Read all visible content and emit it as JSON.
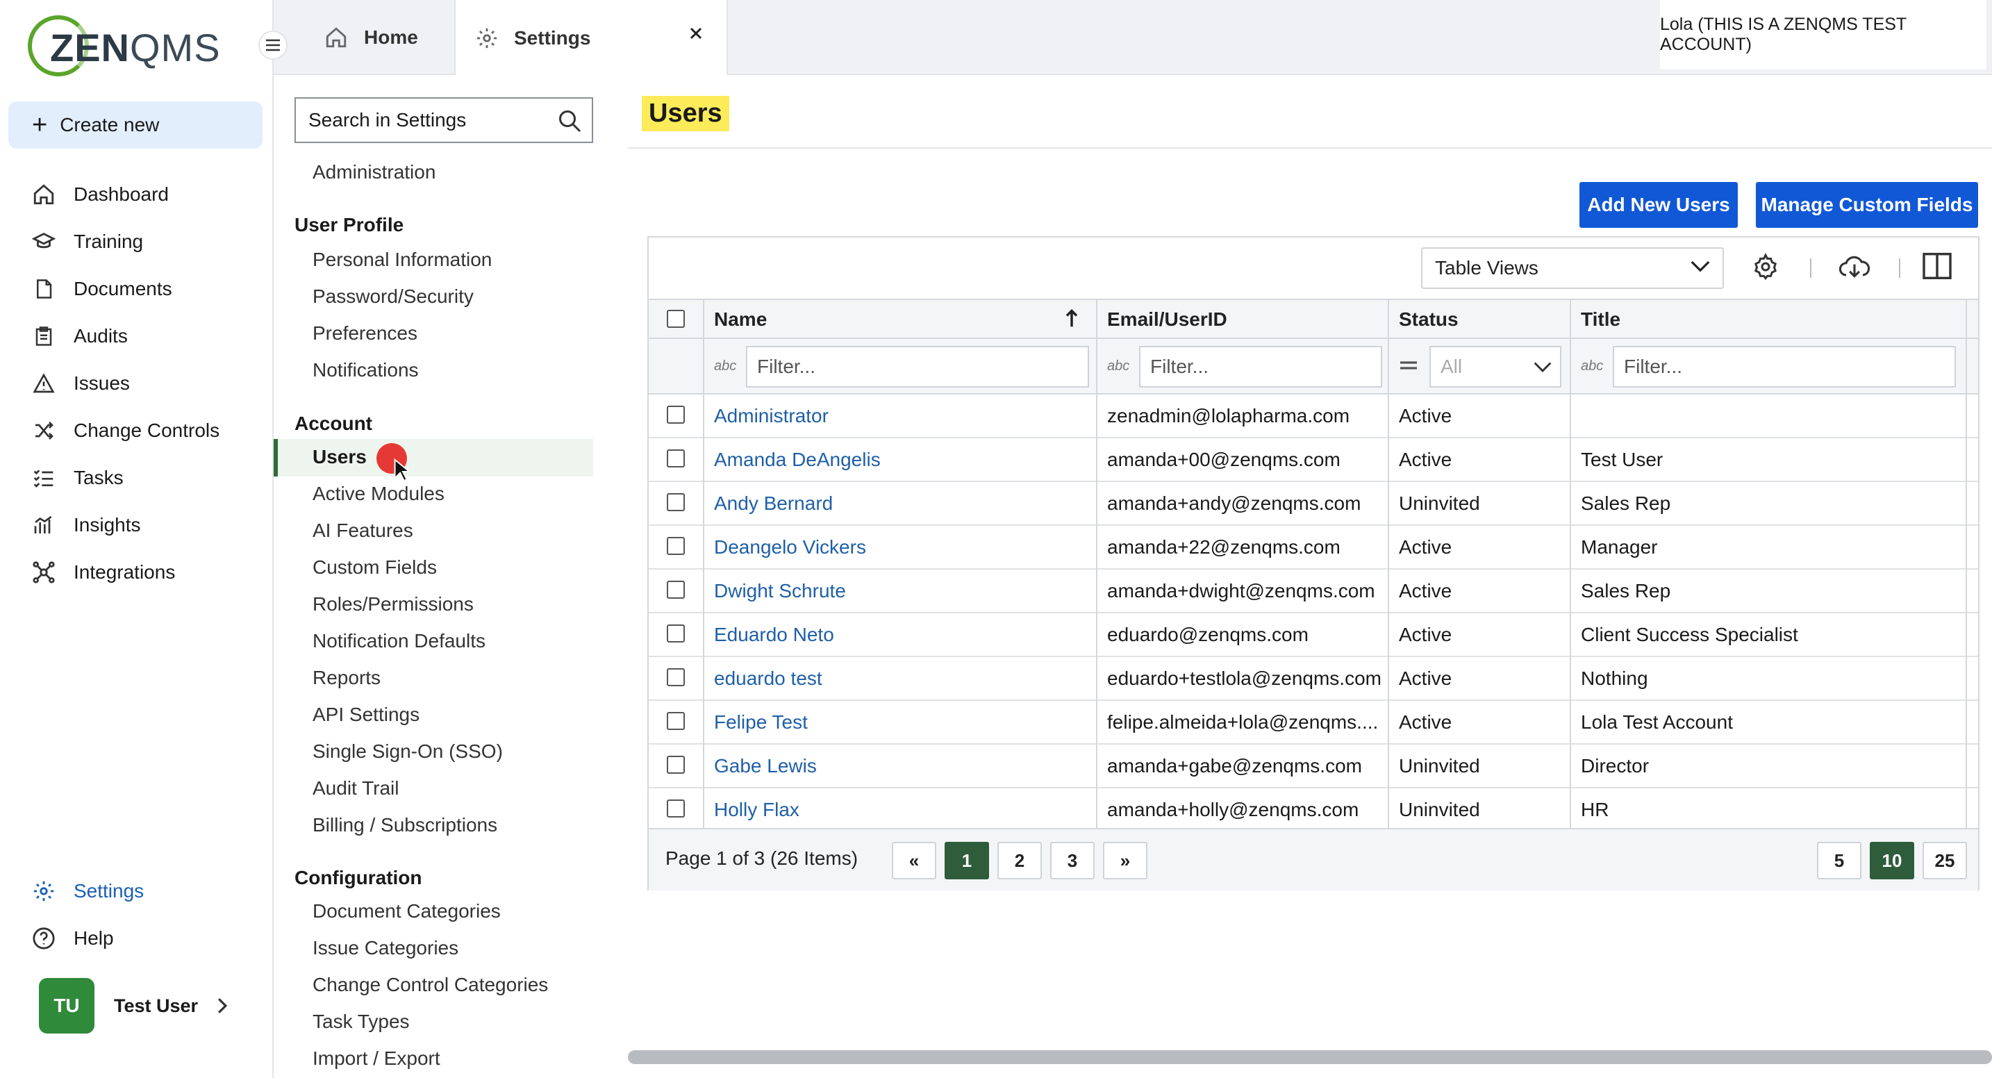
{
  "app": {
    "logo_zen": "ZEN",
    "logo_qms": "QMS",
    "account_label": "Lola (THIS IS A ZENQMS TEST ACCOUNT)"
  },
  "tabs": {
    "home": "Home",
    "settings": "Settings"
  },
  "sidebar": {
    "create_new": "Create new",
    "items": [
      {
        "label": "Dashboard",
        "icon": "home-icon"
      },
      {
        "label": "Training",
        "icon": "graduation-cap-icon"
      },
      {
        "label": "Documents",
        "icon": "document-icon"
      },
      {
        "label": "Audits",
        "icon": "clipboard-icon"
      },
      {
        "label": "Issues",
        "icon": "warning-icon"
      },
      {
        "label": "Change Controls",
        "icon": "shuffle-icon"
      },
      {
        "label": "Tasks",
        "icon": "checklist-icon"
      },
      {
        "label": "Insights",
        "icon": "chart-icon"
      },
      {
        "label": "Integrations",
        "icon": "network-icon"
      }
    ],
    "settings": "Settings",
    "help": "Help",
    "user_initials": "TU",
    "user_name": "Test User"
  },
  "settings_menu": {
    "search_placeholder": "Search in Settings",
    "administration": "Administration",
    "user_profile_head": "User Profile",
    "user_profile": [
      "Personal Information",
      "Password/Security",
      "Preferences",
      "Notifications"
    ],
    "account_head": "Account",
    "account": [
      "Users",
      "Active Modules",
      "AI Features",
      "Custom Fields",
      "Roles/Permissions",
      "Notification Defaults",
      "Reports",
      "API Settings",
      "Single Sign-On (SSO)",
      "Audit Trail",
      "Billing / Subscriptions"
    ],
    "configuration_head": "Configuration",
    "configuration": [
      "Document Categories",
      "Issue Categories",
      "Change Control Categories",
      "Task Types",
      "Import / Export"
    ]
  },
  "main": {
    "title": "Users",
    "add_users": "Add New Users",
    "manage_custom_fields": "Manage Custom Fields",
    "table_views": "Table Views",
    "columns": {
      "name": "Name",
      "email": "Email/UserID",
      "status": "Status",
      "title": "Title"
    },
    "filter_placeholder": "Filter...",
    "status_filter": "All",
    "abc": "abc",
    "rows": [
      {
        "name": "Administrator",
        "email": "zenadmin@lolapharma.com",
        "status": "Active",
        "title": ""
      },
      {
        "name": "Amanda DeAngelis",
        "email": "amanda+00@zenqms.com",
        "status": "Active",
        "title": "Test User"
      },
      {
        "name": "Andy Bernard",
        "email": "amanda+andy@zenqms.com",
        "status": "Uninvited",
        "title": "Sales Rep"
      },
      {
        "name": "Deangelo Vickers",
        "email": "amanda+22@zenqms.com",
        "status": "Active",
        "title": "Manager"
      },
      {
        "name": "Dwight Schrute",
        "email": "amanda+dwight@zenqms.com",
        "status": "Active",
        "title": "Sales Rep"
      },
      {
        "name": "Eduardo Neto",
        "email": "eduardo@zenqms.com",
        "status": "Active",
        "title": "Client Success Specialist"
      },
      {
        "name": "eduardo test",
        "email": "eduardo+testlola@zenqms.com",
        "status": "Active",
        "title": "Nothing"
      },
      {
        "name": "Felipe Test",
        "email": "felipe.almeida+lola@zenqms....",
        "status": "Active",
        "title": "Lola Test Account"
      },
      {
        "name": "Gabe Lewis",
        "email": "amanda+gabe@zenqms.com",
        "status": "Uninvited",
        "title": "Director"
      },
      {
        "name": "Holly Flax",
        "email": "amanda+holly@zenqms.com",
        "status": "Uninvited",
        "title": "HR"
      }
    ],
    "pager": {
      "info": "Page 1 of 3 (26 Items)",
      "prev": "«",
      "pages": [
        "1",
        "2",
        "3"
      ],
      "next": "»",
      "sizes": [
        "5",
        "10",
        "25"
      ],
      "current_page": "1",
      "current_size": "10"
    }
  },
  "colors": {
    "accent": "#1158d6",
    "link": "#1f5fa8",
    "selected_page": "#2f5c3a",
    "title_highlight": "#fdeb5a"
  }
}
